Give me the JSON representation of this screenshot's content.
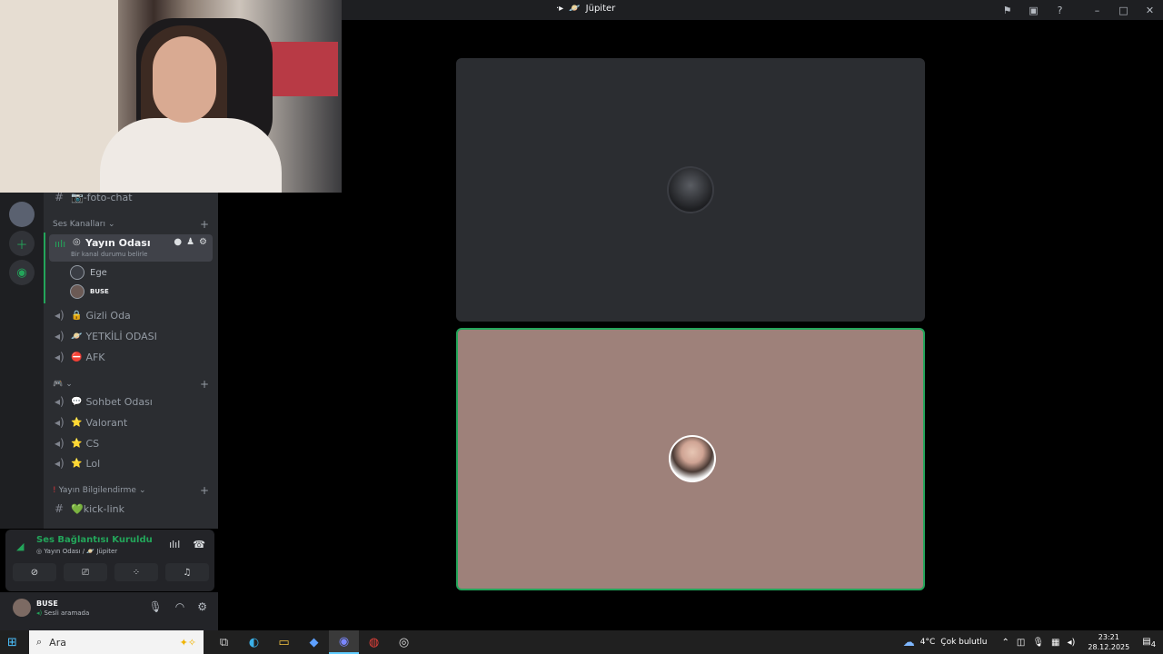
{
  "titlebar": {
    "icon": "server-glyph",
    "emoji": "🪐",
    "title": "Jüpiter",
    "icons": [
      "flag-icon",
      "screen-icon",
      "help-icon",
      "minimize-icon",
      "maximize-icon",
      "close-icon"
    ]
  },
  "channels": {
    "text_channel_top": "📷-foto-chat",
    "voice_category": "Ses Kanalları",
    "active_voice": {
      "name": "Yayın Odası",
      "status": "Bir kanal durumu belirle"
    },
    "members": [
      {
        "name": "Ege"
      },
      {
        "name": "BUSE"
      }
    ],
    "voice_list": [
      {
        "emoji": "🔒",
        "name": "Gizli Oda"
      },
      {
        "emoji": "🪐",
        "name": "YETKİLİ ODASI"
      },
      {
        "emoji": "⛔",
        "name": "AFK"
      }
    ],
    "category2": "🎮",
    "voice_list2": [
      {
        "emoji": "💬",
        "name": "Sohbet Odası"
      },
      {
        "emoji": "⭐",
        "name": "Valorant"
      },
      {
        "emoji": "⭐",
        "name": "CS"
      },
      {
        "emoji": "⭐",
        "name": "Lol"
      }
    ],
    "category3": "Yayın Bilgilendirme",
    "text_channel_bottom": "💚kick-link"
  },
  "voice_panel": {
    "status": "Ses Bağlantısı Kuruldu",
    "sub_channel": "Yayın Odası /",
    "sub_server": "Jüpiter"
  },
  "user": {
    "name": "BUSE",
    "status": "Sesli aramada"
  },
  "taskbar": {
    "search_placeholder": "Ara",
    "weather": "4°C",
    "weather_desc": "Çok bulutlu",
    "time": "23:21",
    "date": "28.12.2025",
    "notifications": "4"
  }
}
